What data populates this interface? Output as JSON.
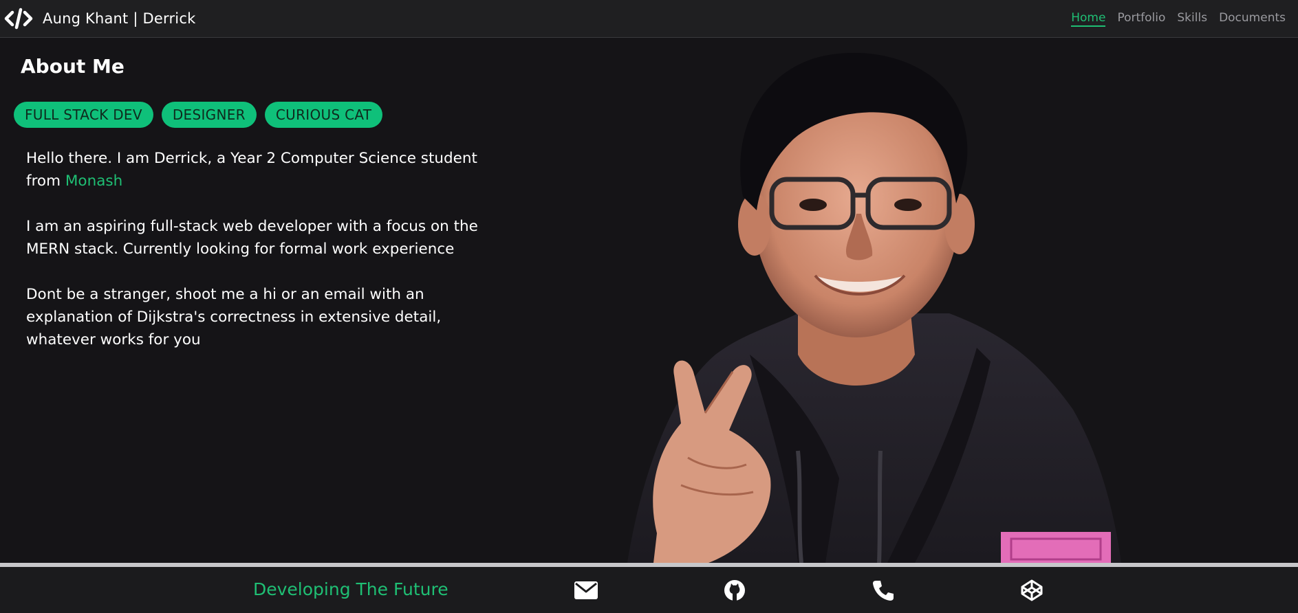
{
  "navbar": {
    "brand_icon": "code-icon",
    "brand": "Aung Khant | Derrick",
    "links": [
      {
        "label": "Home",
        "active": true
      },
      {
        "label": "Portfolio",
        "active": false
      },
      {
        "label": "Skills",
        "active": false
      },
      {
        "label": "Documents",
        "active": false
      }
    ]
  },
  "about": {
    "title": "About Me",
    "tags": [
      "FULL STACK DEV",
      "DESIGNER",
      "CURIOUS CAT"
    ],
    "para1_text": "Hello there. I am Derrick, a Year 2 Computer Science student from ",
    "para1_link": "Monash",
    "para2": "I am an aspiring full-stack web developer with a focus on the MERN stack. Currently looking for formal work experience",
    "para3": "Dont be a stranger, shoot me a hi or an email with an explanation of Dijkstra's correctness in extensive detail, whatever works for you"
  },
  "footer": {
    "tagline": "Developing The Future",
    "icons": [
      "envelope-icon",
      "github-icon",
      "phone-icon",
      "codepen-icon"
    ]
  },
  "colors": {
    "accent": "#1fbf74",
    "tag_bg": "#0fc07a",
    "background": "#151417",
    "navbar_bg": "#1f1f21",
    "footer_bg": "#1b1b1d"
  }
}
